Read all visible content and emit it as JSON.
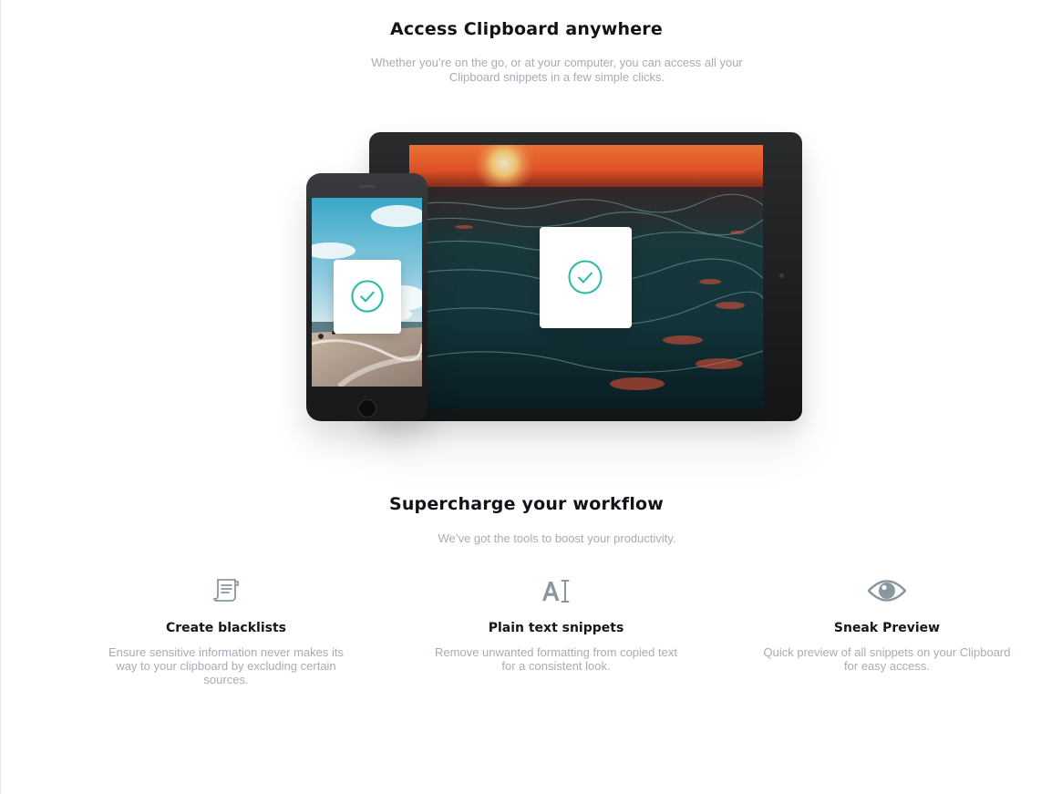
{
  "section1": {
    "title": "Access Clipboard anywhere",
    "subtitle_line1": "Whether you’re on the go, or at your computer, you can access all your",
    "subtitle_line2": "Clipboard snippets in a few simple clicks."
  },
  "devices": {
    "tablet_check_icon": "check-circle-icon",
    "phone_check_icon": "check-circle-icon",
    "accent_color": "#26bba4"
  },
  "section2": {
    "title": "Supercharge your workflow",
    "subtitle": "We’ve got the tools to boost your productivity."
  },
  "features": [
    {
      "icon": "blacklist-document-icon",
      "title": "Create blacklists",
      "desc_line1": "Ensure sensitive information never makes its",
      "desc_line2": "way to your clipboard by excluding certain",
      "desc_line3": "sources."
    },
    {
      "icon": "text-cursor-icon",
      "title": "Plain text snippets",
      "desc_line1": "Remove unwanted formatting from copied text",
      "desc_line2": "for a consistent look."
    },
    {
      "icon": "eye-icon",
      "title": "Sneak Preview",
      "desc_line1": "Quick preview of all snippets on your Clipboard",
      "desc_line2": "for easy access."
    }
  ],
  "colors": {
    "heading": "#111318",
    "muted_text": "#a6acb6",
    "icon_gray": "#8a979f"
  }
}
